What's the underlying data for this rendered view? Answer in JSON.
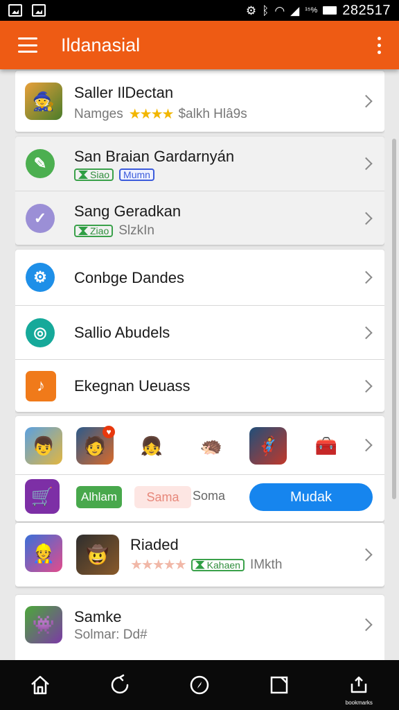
{
  "status_bar": {
    "time": "282517",
    "signal_text": "¹⁵%"
  },
  "app_bar": {
    "title": "Ildanasial"
  },
  "items": [
    {
      "title": "Saller IlDectan",
      "subtitle": "Namges",
      "rating_stars": "★★★★",
      "extra": "$alkh  Hlâ9s",
      "icon": "game-character-icon"
    },
    {
      "title": "San Braian Gardarnyán",
      "chip1": "Siao",
      "chip2": "Mumn",
      "icon": "pencil-icon",
      "icon_color": "#4caf50"
    },
    {
      "title": "Sang Geradkan",
      "chip1": "Ziao",
      "extra": "SlzkIn",
      "icon": "lavender-check-icon",
      "icon_color": "#9b8fd6"
    },
    {
      "title": "Conbge Dandes",
      "icon": "blue-gear-icon",
      "icon_color": "#1e8fe8"
    },
    {
      "title": "Sallio Abudels",
      "icon": "teal-circle-icon",
      "icon_color": "#16a99a"
    },
    {
      "title": "Ekegnan Ueuass",
      "icon": "orange-square-icon",
      "icon_color": "#f07a1a"
    }
  ],
  "strip": {
    "badge": "♥",
    "green_pill": "Alhlam",
    "pink_pill": "Sama",
    "plain_label": "Soma",
    "action_button": "Mudak"
  },
  "rated_item": {
    "title": "Riaded",
    "rating_stars": "★★★★★",
    "chip": "Kahaen",
    "extra": "IMkth"
  },
  "last_item": {
    "title": "Samke",
    "subtitle": "Solmar:  Dd#"
  },
  "bottom_nav": {
    "items": [
      {
        "name": "home-icon",
        "glyph": "⌂"
      },
      {
        "name": "refresh-icon",
        "glyph": "⟳"
      },
      {
        "name": "compass-icon",
        "glyph": "◷"
      },
      {
        "name": "notes-icon",
        "glyph": "◫"
      },
      {
        "name": "share-icon",
        "glyph": "⬈"
      }
    ],
    "last_label": "bookmarks"
  }
}
